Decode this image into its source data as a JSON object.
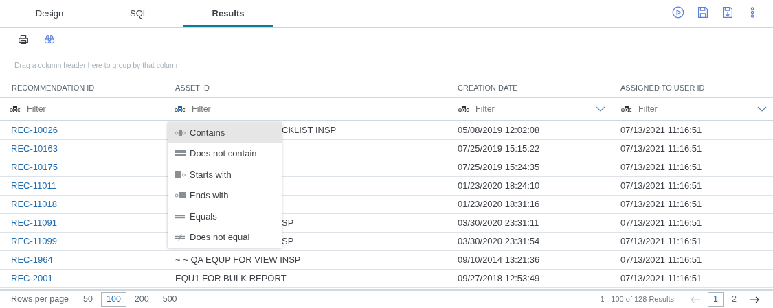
{
  "tabs": [
    {
      "label": "Design",
      "selected": false
    },
    {
      "label": "SQL",
      "selected": false
    },
    {
      "label": "Results",
      "selected": true
    }
  ],
  "group_hint": "Drag a column header here to group by that column",
  "table": {
    "columns": [
      {
        "label": "RECOMMENDATION ID",
        "filter_placeholder": "Filter",
        "dropdown": false
      },
      {
        "label": "ASSET ID",
        "filter_placeholder": "Filter",
        "dropdown": false
      },
      {
        "label": "CREATION DATE",
        "filter_placeholder": "Filter",
        "dropdown": true
      },
      {
        "label": "ASSIGNED TO USER ID",
        "filter_placeholder": "Filter",
        "dropdown": true
      }
    ],
    "rows": [
      {
        "recommendation_id": "REC-10026",
        "asset_id": "CKLIST INSP",
        "creation_date": "05/08/2019 12:02:08",
        "assigned_to_user_id": "07/13/2021 11:16:51"
      },
      {
        "recommendation_id": "REC-10163",
        "creation_date": "07/25/2019 15:15:22",
        "assigned_to_user_id": "07/13/2021 11:16:51"
      },
      {
        "recommendation_id": "REC-10175",
        "creation_date": "07/25/2019 15:24:35",
        "assigned_to_user_id": "07/13/2021 11:16:51"
      },
      {
        "recommendation_id": "REC-11011",
        "creation_date": "01/23/2020 18:24:10",
        "assigned_to_user_id": "07/13/2021 11:16:51"
      },
      {
        "recommendation_id": "REC-11018",
        "creation_date": "01/23/2020 18:31:16",
        "assigned_to_user_id": "07/13/2021 11:16:51"
      },
      {
        "recommendation_id": "REC-11091",
        "asset_id": "SP",
        "creation_date": "03/30/2020 23:31:11",
        "assigned_to_user_id": "07/13/2021 11:16:51"
      },
      {
        "recommendation_id": "REC-11099",
        "asset_id": "SP",
        "creation_date": "03/30/2020 23:31:54",
        "assigned_to_user_id": "07/13/2021 11:16:51"
      },
      {
        "recommendation_id": "REC-1964",
        "asset_id": "~ ~ QA EQUP FOR VIEW INSP",
        "creation_date": "09/10/2014 13:21:36",
        "assigned_to_user_id": "07/13/2021 11:16:51"
      },
      {
        "recommendation_id": "REC-2001",
        "asset_id": "EQU1 FOR BULK REPORT",
        "creation_date": "09/27/2018 12:53:49",
        "assigned_to_user_id": "07/13/2021 11:16:51"
      }
    ]
  },
  "filter_menu": {
    "items": [
      {
        "label": "Contains",
        "kind": "contains",
        "selected": true
      },
      {
        "label": "Does not contain",
        "kind": "not-contains",
        "selected": false
      },
      {
        "label": "Starts with",
        "kind": "starts",
        "selected": false
      },
      {
        "label": "Ends with",
        "kind": "ends",
        "selected": false
      },
      {
        "label": "Equals",
        "kind": "equals",
        "selected": false
      },
      {
        "label": "Does not equal",
        "kind": "not-equals",
        "selected": false
      }
    ]
  },
  "footer": {
    "rows_per_page_label": "Rows per page",
    "page_sizes": [
      {
        "label": "50",
        "selected": false
      },
      {
        "label": "100",
        "selected": true
      },
      {
        "label": "200",
        "selected": false
      },
      {
        "label": "500",
        "selected": false
      }
    ],
    "summary": "1 - 100 of 128 Results",
    "prev_disabled": true,
    "next_disabled": false,
    "pages": [
      {
        "label": "1",
        "selected": true
      },
      {
        "label": "2",
        "selected": false
      }
    ]
  }
}
